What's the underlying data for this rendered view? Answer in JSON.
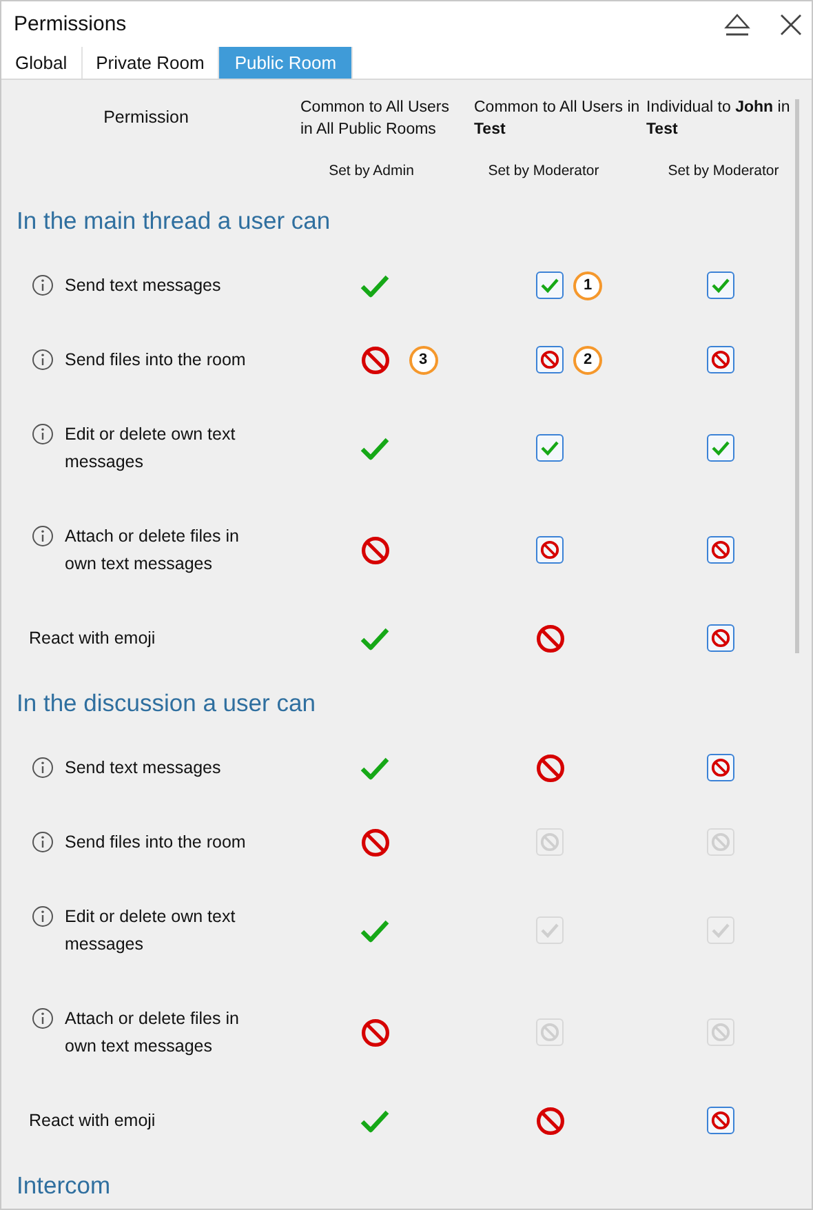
{
  "window": {
    "title": "Permissions"
  },
  "tabs": [
    {
      "label": "Global",
      "selected": false
    },
    {
      "label": "Private Room",
      "selected": false
    },
    {
      "label": "Public Room",
      "selected": true
    }
  ],
  "header": {
    "permission": "Permission",
    "columns": [
      {
        "title": "Common to All Users in All Public Rooms",
        "note": "Set by Admin"
      },
      {
        "title": "Common to All Users in **Test**",
        "note": "Set by Moderator"
      },
      {
        "title": "Individual to **John** in **Test**",
        "note": "Set by Moderator"
      }
    ]
  },
  "sections": [
    {
      "title": "In the main thread a user can",
      "rows": [
        {
          "label": "Send text messages",
          "info": true,
          "cells": [
            {
              "kind": "plain",
              "allowed": true
            },
            {
              "kind": "box",
              "allowed": true,
              "disabled": false,
              "badge": "1"
            },
            {
              "kind": "box",
              "allowed": true,
              "disabled": false
            }
          ]
        },
        {
          "label": "Send files into the room",
          "info": true,
          "cells": [
            {
              "kind": "plain",
              "allowed": false,
              "badge": "3"
            },
            {
              "kind": "box",
              "allowed": false,
              "disabled": false,
              "badge": "2"
            },
            {
              "kind": "box",
              "allowed": false,
              "disabled": false
            }
          ]
        },
        {
          "label": "Edit or delete own text messages",
          "info": true,
          "cells": [
            {
              "kind": "plain",
              "allowed": true
            },
            {
              "kind": "box",
              "allowed": true,
              "disabled": false
            },
            {
              "kind": "box",
              "allowed": true,
              "disabled": false
            }
          ]
        },
        {
          "label": "Attach or delete files in own text messages",
          "info": true,
          "cells": [
            {
              "kind": "plain",
              "allowed": false
            },
            {
              "kind": "box",
              "allowed": false,
              "disabled": false
            },
            {
              "kind": "box",
              "allowed": false,
              "disabled": false
            }
          ]
        },
        {
          "label": "React with emoji",
          "info": false,
          "cells": [
            {
              "kind": "plain",
              "allowed": true
            },
            {
              "kind": "plain",
              "allowed": false
            },
            {
              "kind": "box",
              "allowed": false,
              "disabled": false
            }
          ]
        }
      ]
    },
    {
      "title": "In the discussion a user can",
      "rows": [
        {
          "label": "Send text messages",
          "info": true,
          "cells": [
            {
              "kind": "plain",
              "allowed": true
            },
            {
              "kind": "plain",
              "allowed": false
            },
            {
              "kind": "box",
              "allowed": false,
              "disabled": false
            }
          ]
        },
        {
          "label": "Send files into the room",
          "info": true,
          "cells": [
            {
              "kind": "plain",
              "allowed": false
            },
            {
              "kind": "box",
              "allowed": false,
              "disabled": true
            },
            {
              "kind": "box",
              "allowed": false,
              "disabled": true
            }
          ]
        },
        {
          "label": "Edit or delete own text messages",
          "info": true,
          "cells": [
            {
              "kind": "plain",
              "allowed": true
            },
            {
              "kind": "box",
              "allowed": true,
              "disabled": true
            },
            {
              "kind": "box",
              "allowed": true,
              "disabled": true
            }
          ]
        },
        {
          "label": "Attach or delete files in own text messages",
          "info": true,
          "cells": [
            {
              "kind": "plain",
              "allowed": false
            },
            {
              "kind": "box",
              "allowed": false,
              "disabled": true
            },
            {
              "kind": "box",
              "allowed": false,
              "disabled": true
            }
          ]
        },
        {
          "label": "React with emoji",
          "info": false,
          "cells": [
            {
              "kind": "plain",
              "allowed": true
            },
            {
              "kind": "plain",
              "allowed": false
            },
            {
              "kind": "box",
              "allowed": false,
              "disabled": false
            }
          ]
        }
      ]
    },
    {
      "title": "Intercom"
    }
  ]
}
